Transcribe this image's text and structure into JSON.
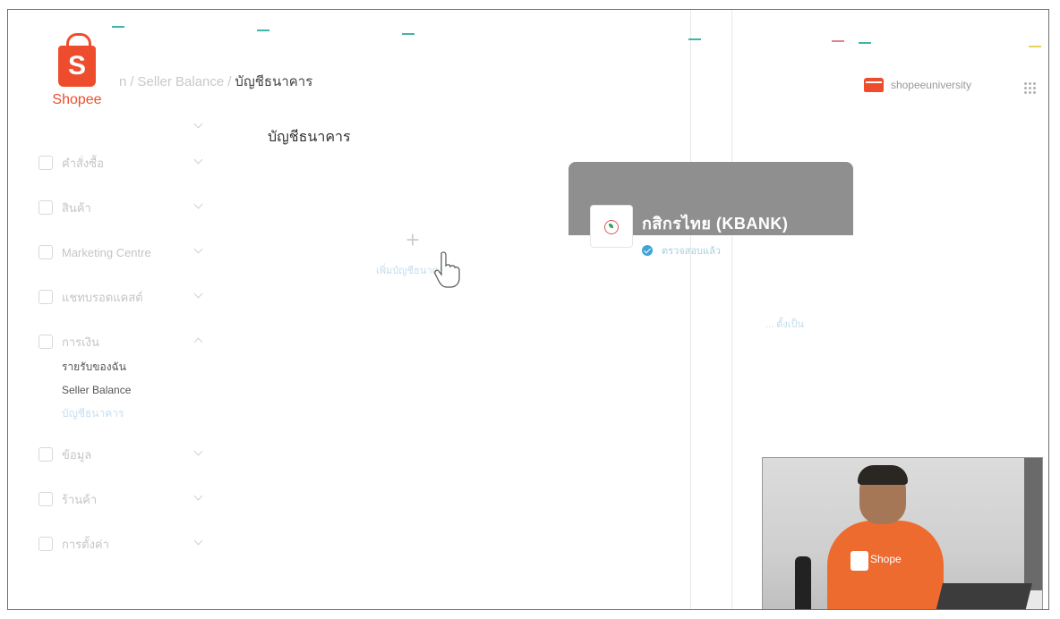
{
  "header": {
    "logo_text": "Shopee",
    "breadcrumb": {
      "part1": "n",
      "part2": "Seller Balance",
      "current": "บัญชีธนาคาร"
    },
    "user": {
      "name": "shopeeuniversity"
    }
  },
  "sidebar": {
    "items": [
      {
        "label": ""
      },
      {
        "label": "คำสั่งซื้อ"
      },
      {
        "label": "สินค้า"
      },
      {
        "label": "Marketing Centre"
      },
      {
        "label": "แชทบรอดแคสต์"
      },
      {
        "label": "การเงิน"
      },
      {
        "label": "ข้อมูล"
      },
      {
        "label": "ร้านค้า"
      },
      {
        "label": "การตั้งค่า"
      }
    ],
    "finance_sub": [
      {
        "label": "รายรับของฉัน"
      },
      {
        "label": "Seller Balance"
      },
      {
        "label": "บัญชีธนาคาร"
      }
    ]
  },
  "main": {
    "title": "บัญชีธนาคาร",
    "add_bank": {
      "plus": "+",
      "label": "เพิ่มบัญชีธนาคาร"
    },
    "bank_card": {
      "name": "กสิกรไทย (KBANK)",
      "status": "ตรวจสอบแล้ว",
      "link": "... ตั้งเป็น"
    }
  },
  "video": {
    "shirt_text": "Shope"
  },
  "colors": {
    "brand": "#ee4d2d",
    "card": "#8f8f8f",
    "accent": "#3fa4d6"
  }
}
